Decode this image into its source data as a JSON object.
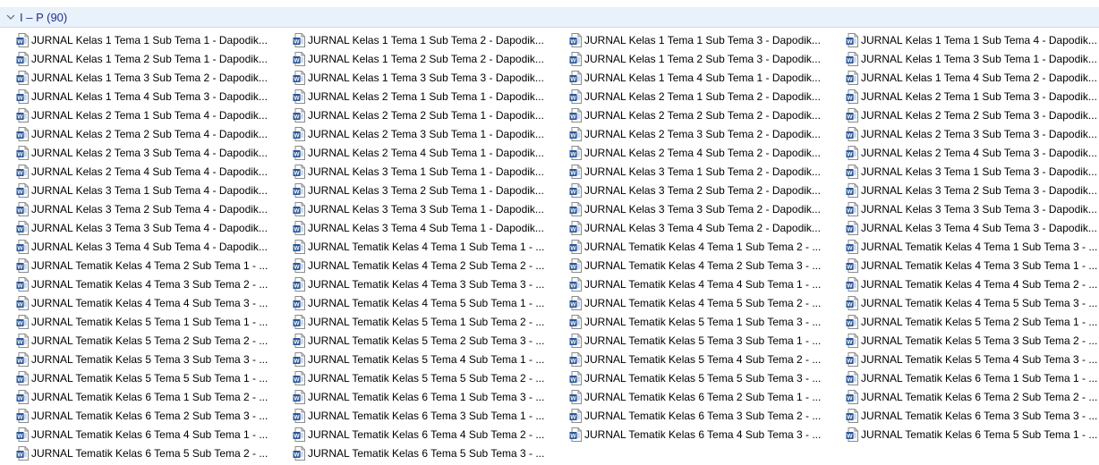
{
  "group": {
    "title": "I – P (90)",
    "toggle_icon": "chevron-down-icon"
  },
  "file_icon": "word-document-icon",
  "files": [
    [
      "JURNAL Kelas 1 Tema 1 Sub Tema 1 - Dapodik...",
      "JURNAL Kelas 1 Tema 1 Sub Tema 2 - Dapodik...",
      "JURNAL Kelas 1 Tema 1 Sub Tema 3 - Dapodik...",
      "JURNAL Kelas 1 Tema 1 Sub Tema 4 - Dapodik..."
    ],
    [
      "JURNAL Kelas 1 Tema 2 Sub Tema 1 - Dapodik...",
      "JURNAL Kelas 1 Tema 2 Sub Tema 2 - Dapodik...",
      "JURNAL Kelas 1 Tema 2 Sub Tema 3 - Dapodik...",
      "JURNAL Kelas 1 Tema 3 Sub Tema 1 - Dapodik..."
    ],
    [
      "JURNAL Kelas 1 Tema 3 Sub Tema 2 - Dapodik...",
      "JURNAL Kelas 1 Tema 3 Sub Tema 3 - Dapodik...",
      "JURNAL Kelas 1 Tema 4 Sub Tema 1 - Dapodik...",
      "JURNAL Kelas 1 Tema 4 Sub Tema 2 - Dapodik..."
    ],
    [
      "JURNAL Kelas 1 Tema 4 Sub Tema 3 - Dapodik...",
      "JURNAL Kelas 2 Tema 1 Sub Tema 1 - Dapodik...",
      "JURNAL Kelas 2 Tema 1 Sub Tema 2 - Dapodik...",
      "JURNAL Kelas 2 Tema 1 Sub Tema 3 - Dapodik..."
    ],
    [
      "JURNAL Kelas 2 Tema 1 Sub Tema 4 - Dapodik...",
      "JURNAL Kelas 2 Tema 2 Sub Tema 1 - Dapodik...",
      "JURNAL Kelas 2 Tema 2 Sub Tema 2 - Dapodik...",
      "JURNAL Kelas 2 Tema 2 Sub Tema 3 - Dapodik..."
    ],
    [
      "JURNAL Kelas 2 Tema 2 Sub Tema 4 - Dapodik...",
      "JURNAL Kelas 2 Tema 3 Sub Tema 1 - Dapodik...",
      "JURNAL Kelas 2 Tema 3 Sub Tema 2 - Dapodik...",
      "JURNAL Kelas 2 Tema 3 Sub Tema 3 - Dapodik..."
    ],
    [
      "JURNAL Kelas 2 Tema 3 Sub Tema 4 - Dapodik...",
      "JURNAL Kelas 2 Tema 4 Sub Tema 1 - Dapodik...",
      "JURNAL Kelas 2 Tema 4 Sub Tema 2 - Dapodik...",
      "JURNAL Kelas 2 Tema 4 Sub Tema 3 - Dapodik..."
    ],
    [
      "JURNAL Kelas 2 Tema 4 Sub Tema 4 - Dapodik...",
      "JURNAL Kelas 3 Tema 1 Sub Tema 1 - Dapodik...",
      "JURNAL Kelas 3 Tema 1 Sub Tema 2 - Dapodik...",
      "JURNAL Kelas 3 Tema 1 Sub Tema 3 - Dapodik..."
    ],
    [
      "JURNAL Kelas 3 Tema 1 Sub Tema 4 - Dapodik...",
      "JURNAL Kelas 3 Tema 2 Sub Tema 1 - Dapodik...",
      "JURNAL Kelas 3 Tema 2 Sub Tema 2 - Dapodik...",
      "JURNAL Kelas 3 Tema 2 Sub Tema 3 - Dapodik..."
    ],
    [
      "JURNAL Kelas 3 Tema 2 Sub Tema 4 - Dapodik...",
      "JURNAL Kelas 3 Tema 3 Sub Tema 1 - Dapodik...",
      "JURNAL Kelas 3 Tema 3 Sub Tema 2 - Dapodik...",
      "JURNAL Kelas 3 Tema 3 Sub Tema 3 - Dapodik..."
    ],
    [
      "JURNAL Kelas 3 Tema 3 Sub Tema 4 - Dapodik...",
      "JURNAL Kelas 3 Tema 4 Sub Tema 1 - Dapodik...",
      "JURNAL Kelas 3 Tema 4 Sub Tema 2 - Dapodik...",
      "JURNAL Kelas 3 Tema 4 Sub Tema 3 - Dapodik..."
    ],
    [
      "JURNAL Kelas 3 Tema 4 Sub Tema 4 - Dapodik...",
      "JURNAL Tematik Kelas 4 Tema 1 Sub Tema 1 - ...",
      "JURNAL Tematik Kelas 4 Tema 1 Sub Tema 2 - ...",
      "JURNAL Tematik Kelas 4 Tema 1 Sub Tema 3 - ..."
    ],
    [
      "JURNAL Tematik Kelas 4 Tema 2 Sub Tema 1 - ...",
      "JURNAL Tematik Kelas 4 Tema 2 Sub Tema 2 - ...",
      "JURNAL Tematik Kelas 4 Tema 2 Sub Tema 3 - ...",
      "JURNAL Tematik Kelas 4 Tema 3 Sub Tema 1 - ..."
    ],
    [
      "JURNAL Tematik Kelas 4 Tema 3 Sub Tema 2 - ...",
      "JURNAL Tematik Kelas 4 Tema 3 Sub Tema 3 - ...",
      "JURNAL Tematik Kelas 4 Tema 4 Sub Tema 1 - ...",
      "JURNAL Tematik Kelas 4 Tema 4 Sub Tema 2 - ..."
    ],
    [
      "JURNAL Tematik Kelas 4 Tema 4 Sub Tema 3 - ...",
      "JURNAL Tematik Kelas 4 Tema 5 Sub Tema 1 - ...",
      "JURNAL Tematik Kelas 4 Tema 5 Sub Tema 2 - ...",
      "JURNAL Tematik Kelas 4 Tema 5 Sub Tema 3 - ..."
    ],
    [
      "JURNAL Tematik Kelas 5 Tema 1 Sub Tema 1 - ...",
      "JURNAL Tematik Kelas 5 Tema 1 Sub Tema 2 - ...",
      "JURNAL Tematik Kelas 5 Tema 1 Sub Tema 3 - ...",
      "JURNAL Tematik Kelas 5 Tema 2 Sub Tema 1 - ..."
    ],
    [
      "JURNAL Tematik Kelas 5 Tema 2 Sub Tema 2 - ...",
      "JURNAL Tematik Kelas 5 Tema 2 Sub Tema 3 - ...",
      "JURNAL Tematik Kelas 5 Tema 3 Sub Tema 1 - ...",
      "JURNAL Tematik Kelas 5 Tema 3 Sub Tema 2 - ..."
    ],
    [
      "JURNAL Tematik Kelas 5 Tema 3 Sub Tema 3 - ...",
      "JURNAL Tematik Kelas 5 Tema 4 Sub Tema 1 - ...",
      "JURNAL Tematik Kelas 5 Tema 4 Sub Tema 2 - ...",
      "JURNAL Tematik Kelas 5 Tema 4 Sub Tema 3 - ..."
    ],
    [
      "JURNAL Tematik Kelas 5 Tema 5 Sub Tema 1 - ...",
      "JURNAL Tematik Kelas 5 Tema 5 Sub Tema 2 - ...",
      "JURNAL Tematik Kelas 5 Tema 5 Sub Tema 3 - ...",
      "JURNAL Tematik Kelas 6 Tema 1 Sub Tema 1 - ..."
    ],
    [
      "JURNAL Tematik Kelas 6 Tema 1 Sub Tema 2 - ...",
      "JURNAL Tematik Kelas 6 Tema 1 Sub Tema 3 - ...",
      "JURNAL Tematik Kelas 6 Tema 2 Sub Tema 1 - ...",
      "JURNAL Tematik Kelas 6 Tema 2 Sub Tema 2 - ..."
    ],
    [
      "JURNAL Tematik Kelas 6 Tema 2 Sub Tema 3 - ...",
      "JURNAL Tematik Kelas 6 Tema 3 Sub Tema 1 - ...",
      "JURNAL Tematik Kelas 6 Tema 3 Sub Tema 2 - ...",
      "JURNAL Tematik Kelas 6 Tema 3 Sub Tema 3 - ..."
    ],
    [
      "JURNAL Tematik Kelas 6 Tema 4 Sub Tema 1 - ...",
      "JURNAL Tematik Kelas 6 Tema 4 Sub Tema 2 - ...",
      "JURNAL Tematik Kelas 6 Tema 4 Sub Tema 3 - ...",
      "JURNAL Tematik Kelas 6 Tema 5 Sub Tema 1 - ..."
    ],
    [
      "JURNAL Tematik Kelas 6 Tema 5 Sub Tema 2 - ...",
      "JURNAL Tematik Kelas 6 Tema 5 Sub Tema 3 - ..."
    ]
  ]
}
